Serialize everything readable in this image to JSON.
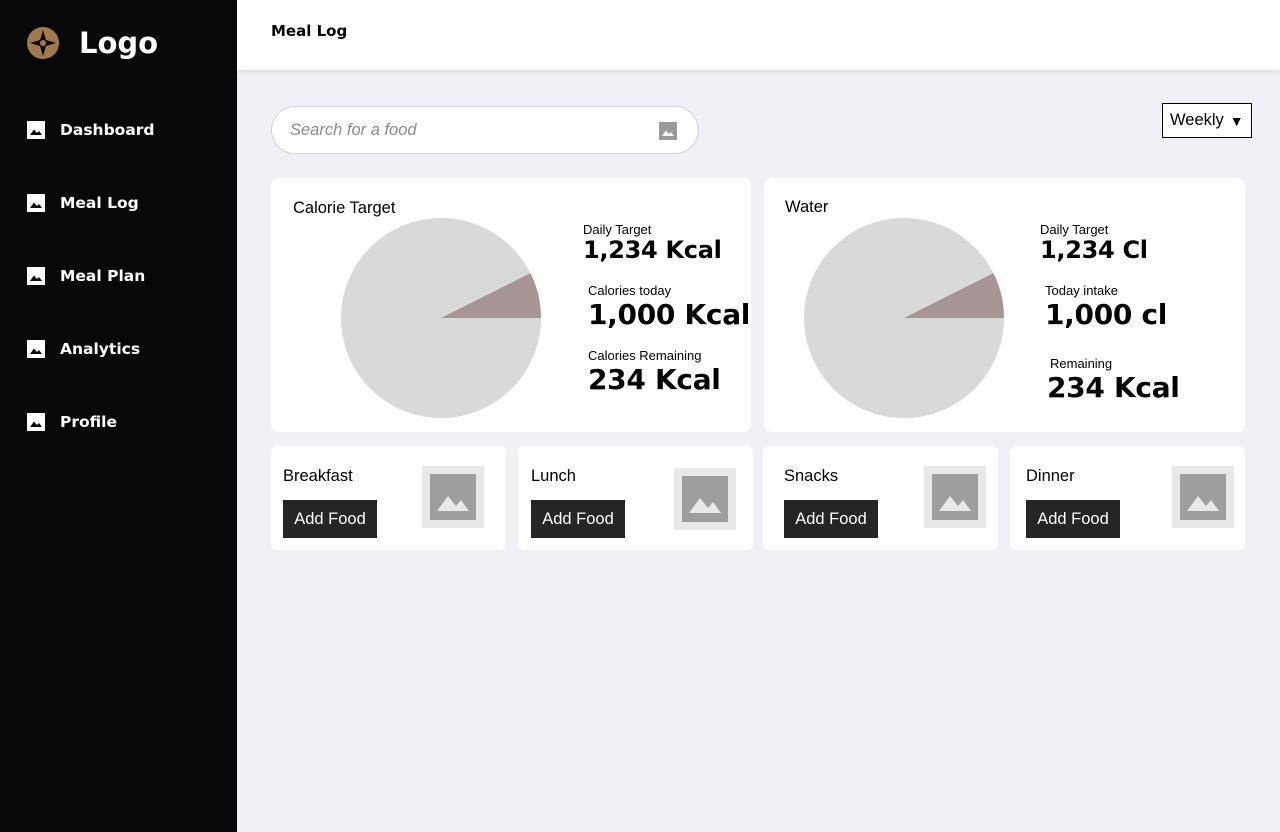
{
  "app": {
    "logo_text": "Logo",
    "logo_icon": "compass-star-icon",
    "accent": "#a07a4a"
  },
  "sidebar": {
    "items": [
      {
        "label": "Dashboard",
        "icon": "image-icon"
      },
      {
        "label": "Meal Log",
        "icon": "image-icon"
      },
      {
        "label": "Meal Plan",
        "icon": "image-icon"
      },
      {
        "label": "Analytics",
        "icon": "image-icon"
      },
      {
        "label": "Profile",
        "icon": "image-icon"
      }
    ]
  },
  "header": {
    "title": "Meal Log"
  },
  "search": {
    "placeholder": "Search for a food",
    "value": "",
    "icon": "image-icon"
  },
  "period": {
    "selected": "Weekly",
    "caret": "▼"
  },
  "calorie": {
    "title": "Calorie Target",
    "daily_target_label": "Daily Target",
    "daily_target_value": "1,234 Kcal",
    "today_label": "Calories today",
    "today_value": "1,000 Kcal",
    "remaining_label": "Calories Remaining",
    "remaining_value": "234 Kcal",
    "pie": {
      "highlight_fraction": 0.074,
      "base_color": "#d9d9d9",
      "highlight_color": "#a79595"
    }
  },
  "water": {
    "title": "Water",
    "daily_target_label": "Daily Target",
    "daily_target_value": "1,234 Cl",
    "today_label": "Today intake",
    "today_value": "1,000 cl",
    "remaining_label": "Remaining",
    "remaining_value": "234 Kcal",
    "pie": {
      "highlight_fraction": 0.074,
      "base_color": "#d9d9d9",
      "highlight_color": "#a79595"
    }
  },
  "meals": [
    {
      "title": "Breakfast",
      "button": "Add Food",
      "icon": "image-placeholder-icon"
    },
    {
      "title": "Lunch",
      "button": "Add Food",
      "icon": "image-placeholder-icon"
    },
    {
      "title": "Snacks",
      "button": "Add Food",
      "icon": "image-placeholder-icon"
    },
    {
      "title": "Dinner",
      "button": "Add Food",
      "icon": "image-placeholder-icon"
    }
  ]
}
